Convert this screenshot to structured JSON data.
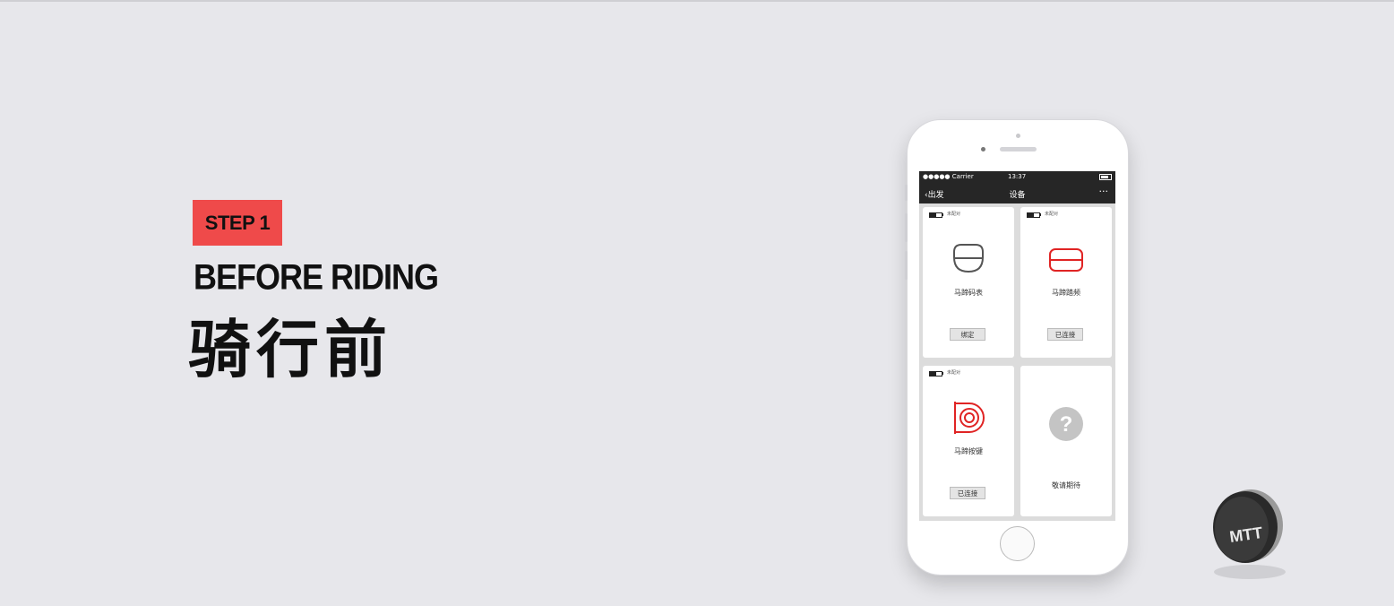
{
  "hero": {
    "step_label": "STEP 1",
    "title_en": "BEFORE RIDING",
    "title_cn": "骑行前"
  },
  "phone": {
    "statusbar": {
      "carrier": "●●●●● Carrier",
      "time": "13:37"
    },
    "navbar": {
      "back_label": "出发",
      "title": "设备",
      "more_label": "···"
    },
    "devices": [
      {
        "pair_status": "未配对",
        "name": "马蹄码表",
        "button": "绑定",
        "icon": "computer-icon",
        "icon_color": "#555555"
      },
      {
        "pair_status": "未配对",
        "name": "马蹄踏频",
        "button": "已连接",
        "icon": "cadence-icon",
        "icon_color": "#e02424"
      },
      {
        "pair_status": "未配对",
        "name": "马蹄按键",
        "button": "已连接",
        "icon": "button-icon",
        "icon_color": "#e02424"
      },
      {
        "name": "敬请期待",
        "icon": "question-icon",
        "icon_color": "#c4c4c4"
      }
    ]
  },
  "puck": {
    "logo_text": "MTT"
  },
  "colors": {
    "accent": "#ef4a4a",
    "background": "#e7e7eb"
  }
}
